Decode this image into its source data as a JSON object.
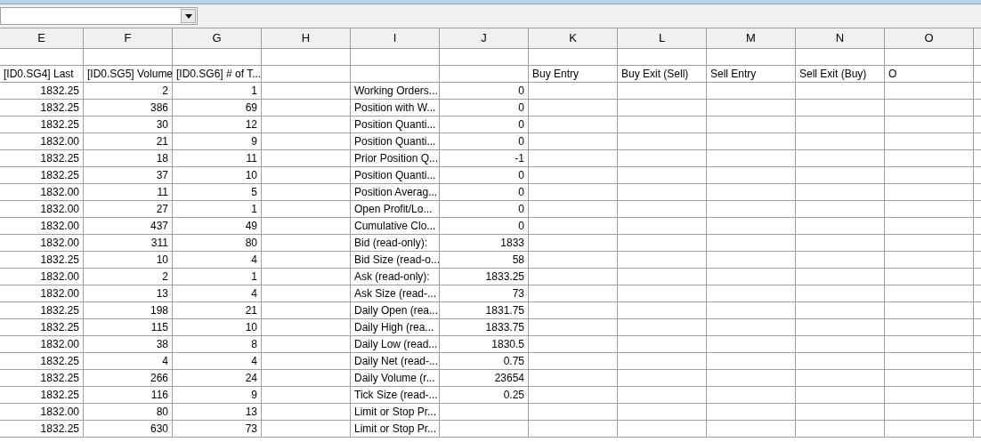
{
  "columns": [
    "E",
    "F",
    "G",
    "H",
    "I",
    "J",
    "K",
    "L",
    "M",
    "N",
    "O"
  ],
  "header_row": {
    "E": "[ID0.SG4] Last",
    "F": "[ID0.SG5] Volume",
    "G": "[ID0.SG6] # of T...",
    "K": "Buy Entry",
    "L": "Buy Exit (Sell)",
    "M": "Sell Entry",
    "N": "Sell Exit (Buy)",
    "O": "O"
  },
  "rows": [
    {
      "E": "1832.25",
      "F": "2",
      "G": "1",
      "I": "Working Orders...",
      "J": "0"
    },
    {
      "E": "1832.25",
      "F": "386",
      "G": "69",
      "I": "Position with W...",
      "J": "0"
    },
    {
      "E": "1832.25",
      "F": "30",
      "G": "12",
      "I": "Position Quanti...",
      "J": "0"
    },
    {
      "E": "1832.00",
      "F": "21",
      "G": "9",
      "I": "Position Quanti...",
      "J": "0"
    },
    {
      "E": "1832.25",
      "F": "18",
      "G": "11",
      "I": "Prior Position Q...",
      "J": "-1"
    },
    {
      "E": "1832.25",
      "F": "37",
      "G": "10",
      "I": "Position Quanti...",
      "J": "0"
    },
    {
      "E": "1832.00",
      "F": "11",
      "G": "5",
      "I": "Position Averag...",
      "J": "0"
    },
    {
      "E": "1832.00",
      "F": "27",
      "G": "1",
      "I": "Open Profit/Lo...",
      "J": "0"
    },
    {
      "E": "1832.00",
      "F": "437",
      "G": "49",
      "I": "Cumulative Clo...",
      "J": "0"
    },
    {
      "E": "1832.00",
      "F": "311",
      "G": "80",
      "I": "Bid (read-only):",
      "J": "1833"
    },
    {
      "E": "1832.25",
      "F": "10",
      "G": "4",
      "I": "Bid Size (read-o...",
      "J": "58"
    },
    {
      "E": "1832.00",
      "F": "2",
      "G": "1",
      "I": "Ask (read-only):",
      "J": "1833.25"
    },
    {
      "E": "1832.00",
      "F": "13",
      "G": "4",
      "I": "Ask Size (read-...",
      "J": "73"
    },
    {
      "E": "1832.25",
      "F": "198",
      "G": "21",
      "I": "Daily Open (rea...",
      "J": "1831.75"
    },
    {
      "E": "1832.25",
      "F": "115",
      "G": "10",
      "I": "Daily High (rea...",
      "J": "1833.75"
    },
    {
      "E": "1832.00",
      "F": "38",
      "G": "8",
      "I": "Daily Low (read...",
      "J": "1830.5"
    },
    {
      "E": "1832.25",
      "F": "4",
      "G": "4",
      "I": "Daily Net (read-...",
      "J": "0.75"
    },
    {
      "E": "1832.25",
      "F": "266",
      "G": "24",
      "I": "Daily Volume (r...",
      "J": "23654"
    },
    {
      "E": "1832.25",
      "F": "116",
      "G": "9",
      "I": "Tick Size (read-...",
      "J": "0.25"
    },
    {
      "E": "1832.00",
      "F": "80",
      "G": "13",
      "I": "Limit or Stop Pr..."
    },
    {
      "E": "1832.25",
      "F": "630",
      "G": "73",
      "I": "Limit or Stop Pr..."
    }
  ]
}
